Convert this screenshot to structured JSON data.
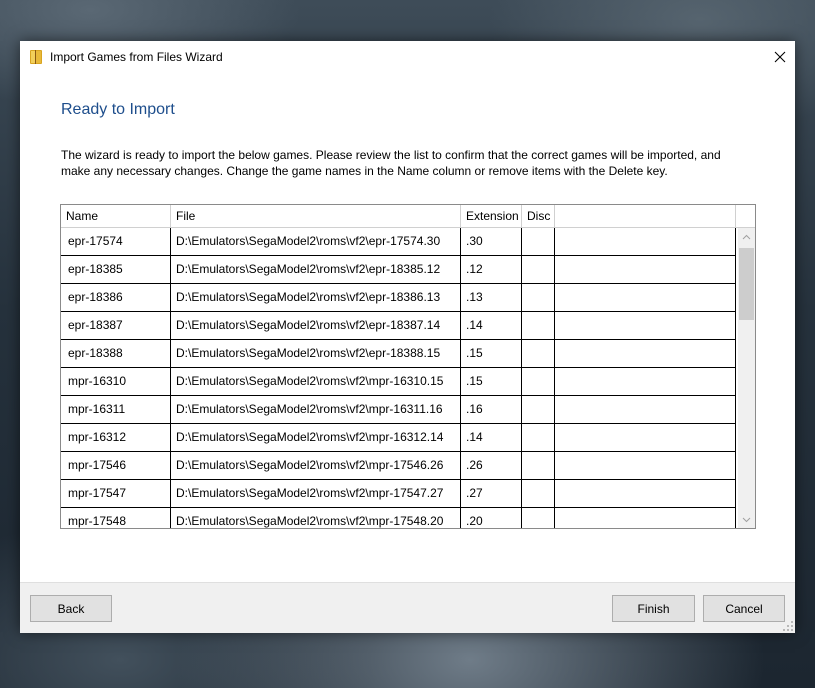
{
  "window": {
    "title": "Import Games from Files Wizard",
    "icon": "wizard-book-icon"
  },
  "page": {
    "heading": "Ready to Import",
    "description": "The wizard is ready to import the below games. Please review the list to confirm that the correct games will be imported, and make any necessary changes. Change the game names in the Name column or remove items with the Delete key."
  },
  "grid": {
    "columns": [
      "Name",
      "File",
      "Extension",
      "Disc"
    ],
    "rows": [
      {
        "name": "epr-17574",
        "file": "D:\\Emulators\\SegaModel2\\roms\\vf2\\epr-17574.30",
        "ext": ".30",
        "disc": ""
      },
      {
        "name": "epr-18385",
        "file": "D:\\Emulators\\SegaModel2\\roms\\vf2\\epr-18385.12",
        "ext": ".12",
        "disc": ""
      },
      {
        "name": "epr-18386",
        "file": "D:\\Emulators\\SegaModel2\\roms\\vf2\\epr-18386.13",
        "ext": ".13",
        "disc": ""
      },
      {
        "name": "epr-18387",
        "file": "D:\\Emulators\\SegaModel2\\roms\\vf2\\epr-18387.14",
        "ext": ".14",
        "disc": ""
      },
      {
        "name": "epr-18388",
        "file": "D:\\Emulators\\SegaModel2\\roms\\vf2\\epr-18388.15",
        "ext": ".15",
        "disc": ""
      },
      {
        "name": "mpr-16310",
        "file": "D:\\Emulators\\SegaModel2\\roms\\vf2\\mpr-16310.15",
        "ext": ".15",
        "disc": ""
      },
      {
        "name": "mpr-16311",
        "file": "D:\\Emulators\\SegaModel2\\roms\\vf2\\mpr-16311.16",
        "ext": ".16",
        "disc": ""
      },
      {
        "name": "mpr-16312",
        "file": "D:\\Emulators\\SegaModel2\\roms\\vf2\\mpr-16312.14",
        "ext": ".14",
        "disc": ""
      },
      {
        "name": "mpr-17546",
        "file": "D:\\Emulators\\SegaModel2\\roms\\vf2\\mpr-17546.26",
        "ext": ".26",
        "disc": ""
      },
      {
        "name": "mpr-17547",
        "file": "D:\\Emulators\\SegaModel2\\roms\\vf2\\mpr-17547.27",
        "ext": ".27",
        "disc": ""
      },
      {
        "name": "mpr-17548",
        "file": "D:\\Emulators\\SegaModel2\\roms\\vf2\\mpr-17548.20",
        "ext": ".20",
        "disc": ""
      }
    ]
  },
  "buttons": {
    "back": "Back",
    "finish": "Finish",
    "cancel": "Cancel"
  },
  "colors": {
    "heading": "#1e4e8c",
    "footer": "#f0f0f0",
    "button": "#e1e1e1"
  }
}
